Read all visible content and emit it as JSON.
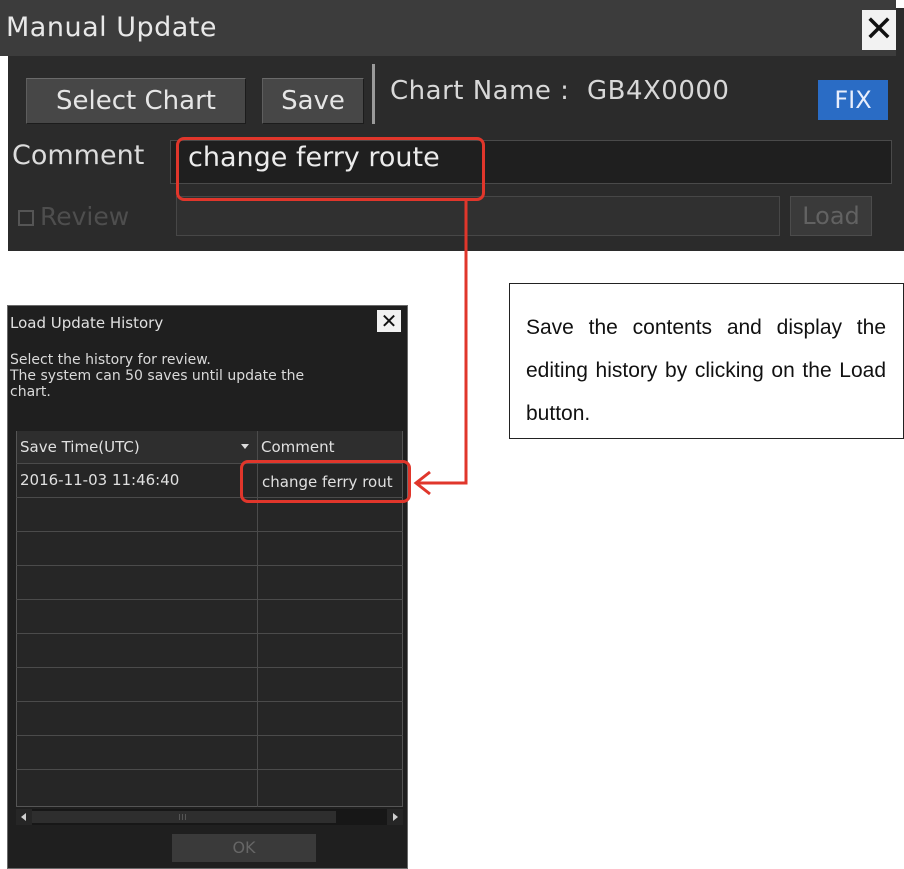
{
  "manual_update": {
    "title": "Manual Update",
    "select_chart_label": "Select Chart",
    "save_label": "Save",
    "chart_name_label": "Chart Name :  GB4X0000",
    "fix_label": "FIX",
    "comment_label": "Comment",
    "comment_value": "change ferry route",
    "review_label": "Review",
    "load_label": "Load"
  },
  "load_history": {
    "title": "Load Update History",
    "description_line1": "Select the history for review.",
    "description_line2": "The system can 50 saves until update the",
    "description_line3": "chart.",
    "columns": [
      "Save Time(UTC)",
      "Comment"
    ],
    "rows": [
      {
        "save_time": "2016-11-03 11:46:40",
        "comment": "change ferry rout"
      }
    ],
    "ok_label": "OK"
  },
  "callout": {
    "text": "Save the contents and display the editing history by clicking on the Load button."
  },
  "colors": {
    "highlight": "#e0362b",
    "fix_button": "#2a6cc5",
    "panel_bg": "#2b2b2b"
  }
}
